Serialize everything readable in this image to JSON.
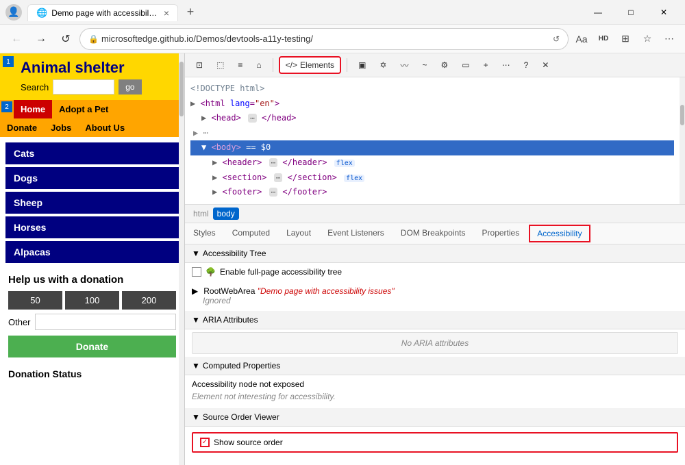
{
  "titlebar": {
    "tab_title": "Demo page with accessibility issu",
    "favicon": "🌐",
    "close_tab_label": "×",
    "new_tab_label": "+",
    "minimize": "—",
    "maximize": "□",
    "close_win": "✕"
  },
  "addressbar": {
    "url": "microsoftedge.github.io/Demos/devtools-a11y-testing/",
    "back_label": "←",
    "forward_label": "→",
    "refresh_label": "↺",
    "home_label": "⌂"
  },
  "browser_page": {
    "badge1": "1",
    "badge2": "2",
    "site_title": "Animal shelter",
    "search_label": "Search",
    "search_placeholder": "",
    "go_btn": "go",
    "nav_home": "Home",
    "nav_adopt": "Adopt a Pet",
    "nav_donate": "Donate",
    "nav_jobs": "Jobs",
    "nav_about": "About Us",
    "animals": [
      "Cats",
      "Dogs",
      "Sheep",
      "Horses",
      "Alpacas"
    ],
    "donation_title": "Help us with a donation",
    "amount_50": "50",
    "amount_100": "100",
    "amount_200": "200",
    "other_label": "Other",
    "donate_btn": "Donate",
    "donation_status_label": "Donation Status"
  },
  "devtools": {
    "tools": [
      {
        "name": "inspect",
        "icon": "⊡",
        "label": ""
      },
      {
        "name": "device",
        "icon": "⬚",
        "label": ""
      },
      {
        "name": "responsive",
        "icon": "≡",
        "label": ""
      },
      {
        "name": "home",
        "icon": "⌂",
        "label": ""
      },
      {
        "name": "elements",
        "icon": "</> Elements",
        "label": "Elements",
        "active": true
      },
      {
        "name": "console",
        "icon": "▣",
        "label": ""
      },
      {
        "name": "sources",
        "icon": "✡",
        "label": ""
      },
      {
        "name": "network",
        "icon": "〰",
        "label": ""
      },
      {
        "name": "performance",
        "icon": "~",
        "label": ""
      },
      {
        "name": "settings2",
        "icon": "⚙",
        "label": ""
      },
      {
        "name": "layers",
        "icon": "▭",
        "label": ""
      },
      {
        "name": "more-tools",
        "icon": "+",
        "label": ""
      },
      {
        "name": "more-devtools",
        "icon": "⋯",
        "label": ""
      },
      {
        "name": "help",
        "icon": "?",
        "label": ""
      },
      {
        "name": "close-devtools",
        "icon": "✕",
        "label": ""
      }
    ],
    "dom": {
      "lines": [
        {
          "text": "<!DOCTYPE html>",
          "type": "comment"
        },
        {
          "text": "<html lang=\"en\">",
          "type": "tag"
        },
        {
          "text": "<head> ⋯ </head>",
          "type": "tag"
        },
        {
          "text": "<body> == $0",
          "type": "selected",
          "indent": 1
        },
        {
          "text": "<header> ⋯ </header>",
          "type": "tag",
          "badge": "flex",
          "indent": 2
        },
        {
          "text": "<section> ⋯ </section>",
          "type": "tag",
          "badge": "flex",
          "indent": 2
        },
        {
          "text": "<footer> ⋯ </footer>",
          "type": "tag",
          "indent": 2
        }
      ]
    },
    "breadcrumb": {
      "items": [
        {
          "label": "html",
          "active": false
        },
        {
          "label": "body",
          "active": true
        }
      ]
    },
    "tabs": [
      {
        "label": "Styles",
        "active": false
      },
      {
        "label": "Computed",
        "active": false
      },
      {
        "label": "Layout",
        "active": false
      },
      {
        "label": "Event Listeners",
        "active": false
      },
      {
        "label": "DOM Breakpoints",
        "active": false
      },
      {
        "label": "Properties",
        "active": false
      },
      {
        "label": "Accessibility",
        "active": true
      }
    ],
    "accessibility": {
      "tree_header": "▼ Accessibility Tree",
      "enable_label": "Enable full-page accessibility tree",
      "root_line1": "▶ RootWebArea \"Demo page with accessibility issues\"",
      "root_ignored": "Ignored",
      "aria_header": "▼ ARIA Attributes",
      "aria_empty": "No ARIA attributes",
      "computed_header": "▼ Computed Properties",
      "computed_line1": "Accessibility node not exposed",
      "computed_line2": "Element not interesting for accessibility.",
      "source_header": "▼ Source Order Viewer",
      "show_source_order": "Show source order"
    }
  }
}
